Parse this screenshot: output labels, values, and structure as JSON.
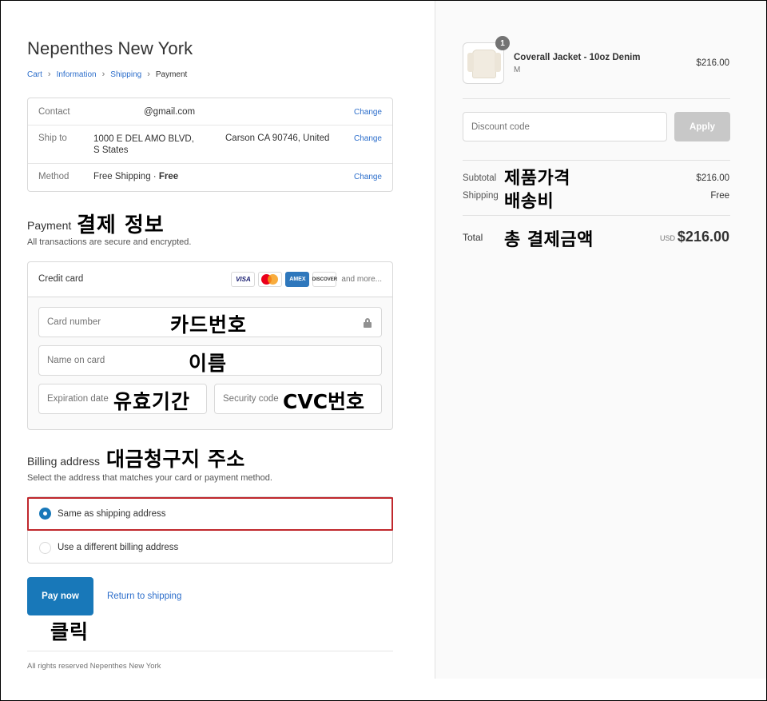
{
  "shop": {
    "name": "Nepenthes New York"
  },
  "breadcrumb": [
    "Cart",
    "Information",
    "Shipping",
    "Payment"
  ],
  "review": {
    "contact_label": "Contact",
    "contact_value": "@gmail.com",
    "ship_label": "Ship to",
    "ship_value_1": "1000 E DEL AMO BLVD, S States",
    "ship_value_2": "Carson CA 90746, United",
    "method_label": "Method",
    "method_value": "Free Shipping · ",
    "method_price": "Free",
    "change_label": "Change"
  },
  "payment": {
    "title": "Payment",
    "subtitle": "All transactions are secure and encrypted.",
    "method_label": "Credit card",
    "brands": [
      "VISA",
      "AMEX",
      "DISCOVER"
    ],
    "more_label": "and more...",
    "card_number_placeholder": "Card number",
    "name_placeholder": "Name on card",
    "expiration_placeholder": "Expiration date",
    "security_placeholder": "Security code"
  },
  "billing": {
    "title": "Billing address",
    "subtitle": "Select the address that matches your card or payment method.",
    "option_same": "Same as shipping address",
    "option_different": "Use a different billing address",
    "selected": "same"
  },
  "actions": {
    "pay_label": "Pay now",
    "return_label": "Return to shipping"
  },
  "footer": {
    "text": "All rights reserved Nepenthes New York"
  },
  "annotations": {
    "payment_info": "결제 정보",
    "card_number": "카드번호",
    "name": "이름",
    "expiry": "유효기간",
    "cvc": "CVC번호",
    "billing_address": "대금청구지 주소",
    "click": "클릭",
    "product_price": "제품가격",
    "shipping_fee": "배송비",
    "total_amount": "총 결제금액"
  },
  "order": {
    "item_name": "Coverall Jacket - 10oz Denim",
    "item_variant": "M",
    "item_price": "$216.00",
    "item_qty": "1",
    "discount_placeholder": "Discount code",
    "apply_label": "Apply",
    "subtotal_label": "Subtotal",
    "subtotal_value": "$216.00",
    "shipping_label": "Shipping",
    "shipping_value": "Free",
    "total_label": "Total",
    "total_currency": "USD",
    "total_value": "$216.00"
  },
  "colors": {
    "accent": "#1878b9",
    "link": "#2c6ecb",
    "highlight": "#c0282d"
  }
}
